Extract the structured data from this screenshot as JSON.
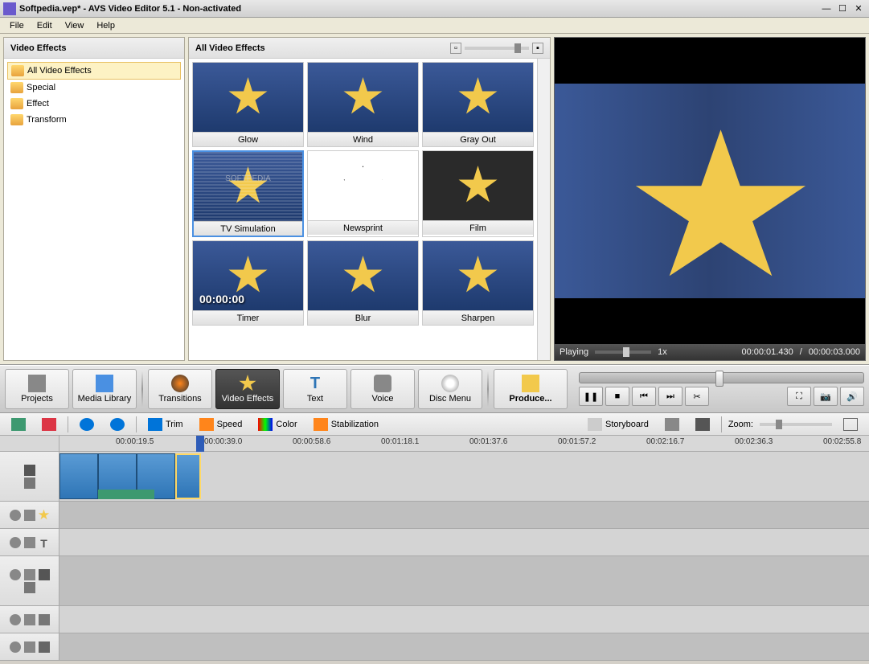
{
  "window": {
    "title": "Softpedia.vep* - AVS Video Editor 5.1 - Non-activated"
  },
  "menu": {
    "file": "File",
    "edit": "Edit",
    "view": "View",
    "help": "Help"
  },
  "sidebar": {
    "header": "Video Effects",
    "items": [
      {
        "label": "All Video Effects",
        "selected": true
      },
      {
        "label": "Special"
      },
      {
        "label": "Effect"
      },
      {
        "label": "Transform"
      }
    ]
  },
  "effects": {
    "header": "All Video Effects",
    "items": [
      {
        "label": "Glow"
      },
      {
        "label": "Wind"
      },
      {
        "label": "Gray Out"
      },
      {
        "label": "TV Simulation",
        "selected": true,
        "variant": "tvsim",
        "watermark": "SOFTPEDIA"
      },
      {
        "label": "Newsprint",
        "variant": "newsprint"
      },
      {
        "label": "Film",
        "variant": "film"
      },
      {
        "label": "Timer",
        "overlay": "00:00:00"
      },
      {
        "label": "Blur"
      },
      {
        "label": "Sharpen"
      }
    ]
  },
  "preview": {
    "status": "Playing",
    "speed": "1x",
    "position": "00:00:01.430",
    "duration": "00:00:03.000",
    "sep": " / "
  },
  "toolbar": {
    "projects": "Projects",
    "media_library": "Media Library",
    "transitions": "Transitions",
    "video_effects": "Video Effects",
    "text": "Text",
    "voice": "Voice",
    "disc_menu": "Disc Menu",
    "produce": "Produce..."
  },
  "tl_toolbar": {
    "trim": "Trim",
    "speed": "Speed",
    "color": "Color",
    "stabilization": "Stabilization",
    "storyboard": "Storyboard",
    "zoom": "Zoom:"
  },
  "ruler": {
    "marks": [
      "00:00:19.5",
      "00:00:39.0",
      "00:00:58.6",
      "00:01:18.1",
      "00:01:37.6",
      "00:01:57.2",
      "00:02:16.7",
      "00:02:36.3",
      "00:02:55.8"
    ]
  }
}
